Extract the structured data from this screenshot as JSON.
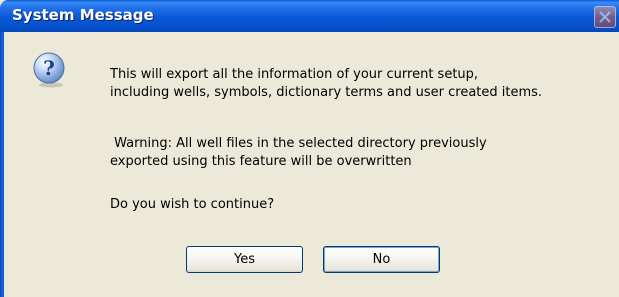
{
  "window": {
    "title": "System Message"
  },
  "icons": {
    "title_close": "close-icon",
    "message": "question-icon"
  },
  "message": {
    "line1": "This will export all the information of your current setup,",
    "line2": "including wells, symbols, dictionary terms and user created items.",
    "line3": " Warning: All well files in the selected directory previously",
    "line4": "exported using this feature will be overwritten",
    "line5": "Do you wish to continue?"
  },
  "buttons": {
    "yes_label": "Yes",
    "no_label": "No"
  },
  "colors": {
    "titlebar": "#0A58D6",
    "dialog_background": "#ECE9D8",
    "button_border": "#003C74"
  }
}
